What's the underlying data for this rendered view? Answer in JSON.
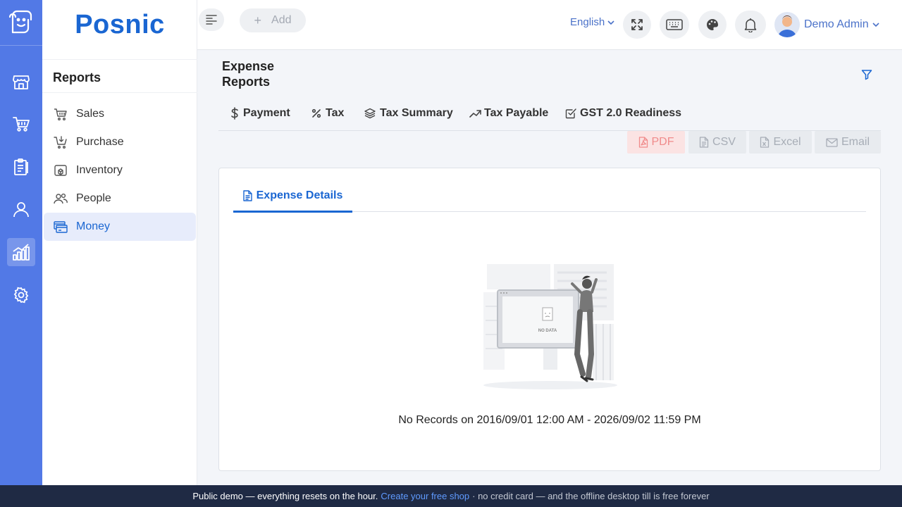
{
  "rail": {
    "items": [
      {
        "icon": "store-icon"
      },
      {
        "icon": "cart-icon"
      },
      {
        "icon": "clipboard-icon"
      },
      {
        "icon": "user-icon"
      },
      {
        "icon": "reports-chart-icon",
        "active": true
      },
      {
        "icon": "gear-icon"
      }
    ]
  },
  "sidebar": {
    "brand": "Posnic",
    "title": "Reports",
    "items": [
      {
        "label": "Sales",
        "icon": "basket-icon"
      },
      {
        "label": "Purchase",
        "icon": "cart-download-icon"
      },
      {
        "label": "Inventory",
        "icon": "box-icon"
      },
      {
        "label": "People",
        "icon": "people-icon"
      },
      {
        "label": "Money",
        "icon": "money-icon",
        "active": true
      }
    ]
  },
  "topbar": {
    "add_label": "Add",
    "language": "English",
    "user_name": "Demo Admin"
  },
  "main": {
    "title_line1": "Expense",
    "title_line2": "Reports",
    "tabs": [
      {
        "label": "Payment",
        "icon": "dollar-icon"
      },
      {
        "label": "Tax",
        "icon": "percent-icon"
      },
      {
        "label": "Tax Summary",
        "icon": "layers-icon"
      },
      {
        "label": "Tax Payable",
        "icon": "trend-up-icon"
      },
      {
        "label": "GST 2.0 Readiness",
        "icon": "check-square-icon"
      }
    ],
    "actions": {
      "pdf": "PDF",
      "csv": "CSV",
      "excel": "Excel",
      "email": "Email"
    },
    "card_tab": "Expense Details",
    "no_data_label": "NO DATA",
    "no_records": "No Records on 2016/09/01 12:00 AM - 2026/09/02 11:59 PM"
  },
  "footer": {
    "text": "Public demo — everything resets on the hour.",
    "link": "Create your free shop",
    "rest": "· no credit card — and the offline desktop till is free forever"
  },
  "colors": {
    "rail": "#5279e6",
    "brand": "#1a66d2",
    "footer": "#1f2a44",
    "pdf_bg": "#fbe3e3"
  }
}
